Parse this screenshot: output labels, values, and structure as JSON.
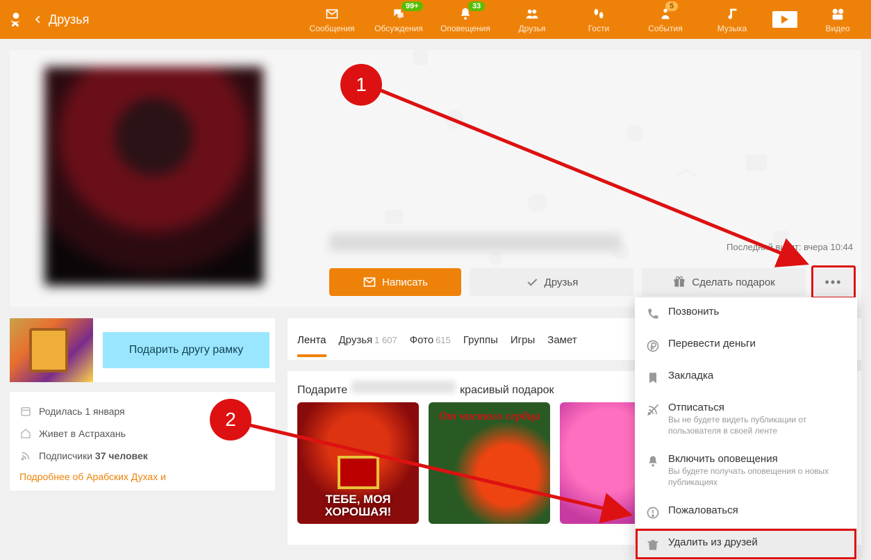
{
  "header": {
    "title": "Друзья",
    "nav": [
      {
        "label": "Сообщения",
        "icon": "mail-icon",
        "badge": null
      },
      {
        "label": "Обсуждения",
        "icon": "chat-icon",
        "badge": "99+"
      },
      {
        "label": "Оповещения",
        "icon": "bell-icon",
        "badge": "33"
      },
      {
        "label": "Друзья",
        "icon": "friends-icon",
        "badge": null
      },
      {
        "label": "Гости",
        "icon": "footsteps-icon",
        "badge": null
      },
      {
        "label": "События",
        "icon": "events-icon",
        "badge": null,
        "badge_alt": "5"
      },
      {
        "label": "Музыка",
        "icon": "music-icon",
        "badge": null
      },
      {
        "label": "Видео",
        "icon": "video-icon",
        "badge": null
      }
    ]
  },
  "profile": {
    "last_visit": "Последний визит: вчера 10:44",
    "actions": {
      "write": "Написать",
      "friends": "Друзья",
      "gift": "Сделать подарок",
      "more": "•••"
    }
  },
  "promo": {
    "text": "Подарить другу рамку"
  },
  "info": {
    "born": "Родилась 1 января",
    "lives": "Живет в Астрахань",
    "subscribers_label": "Подписчики",
    "subscribers_count": "37 человек",
    "more_link": "Подробнее об Арабских Духах и"
  },
  "tabs": [
    {
      "label": "Лента",
      "count": ""
    },
    {
      "label": "Друзья",
      "count": "1 607"
    },
    {
      "label": "Фото",
      "count": "615"
    },
    {
      "label": "Группы",
      "count": ""
    },
    {
      "label": "Игры",
      "count": ""
    },
    {
      "label": "Замет",
      "count": ""
    }
  ],
  "gift": {
    "title_pre": "Подарите",
    "title_post": "красивый подарок",
    "cards": [
      "ТЕБЕ, МОЯ ХОРОШАЯ!",
      "От чистого сердца",
      ""
    ]
  },
  "dropdown": [
    {
      "icon": "phone-icon",
      "label": "Позвонить",
      "sub": ""
    },
    {
      "icon": "ruble-icon",
      "label": "Перевести деньги",
      "sub": ""
    },
    {
      "icon": "bookmark-icon",
      "label": "Закладка",
      "sub": ""
    },
    {
      "icon": "unsubscribe-icon",
      "label": "Отписаться",
      "sub": "Вы не будете видеть публикации от пользователя в своей ленте"
    },
    {
      "icon": "bell-icon",
      "label": "Включить оповещения",
      "sub": "Вы будете получать оповещения о новых публикациях"
    },
    {
      "icon": "report-icon",
      "label": "Пожаловаться",
      "sub": ""
    },
    {
      "icon": "trash-icon",
      "label": "Удалить из друзей",
      "sub": "",
      "highlight": true
    }
  ],
  "annotations": {
    "step1": "1",
    "step2": "2"
  }
}
